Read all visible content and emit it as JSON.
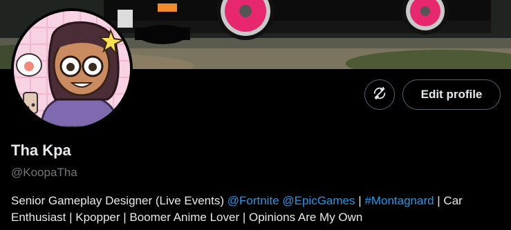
{
  "profile": {
    "display_name": "Tha Kpa",
    "handle": "@KoopaTha",
    "bio": {
      "part1": "Senior Gameplay Designer (Live Events) ",
      "mention1": "@Fortnite",
      "space1": " ",
      "mention2": "@EpicGames",
      "sep1": " | ",
      "hashtag": "#Montagnard",
      "part2": " | Car Enthusiast | Kpopper | Boomer Anime Lover | Opinions Are My Own"
    }
  },
  "actions": {
    "refresh_icon": "sync-circle-arrows-icon",
    "edit_profile_label": "Edit profile"
  },
  "colors": {
    "background": "#000000",
    "text_primary": "#e7e9ea",
    "text_secondary": "#71767b",
    "link": "#1d9bf0",
    "button_border": "#536471",
    "car_wheel": "#e8286e"
  }
}
